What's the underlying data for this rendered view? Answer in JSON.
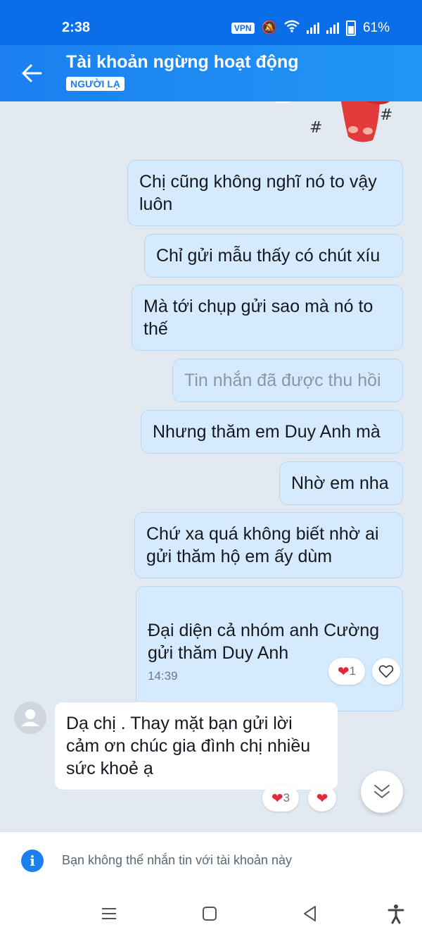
{
  "status": {
    "time": "2:38",
    "vpn": "VPN",
    "battery": "61%"
  },
  "header": {
    "title": "Tài khoản ngừng hoạt động",
    "badge": "NGƯỜI LẠ"
  },
  "messages": [
    {
      "text": "Chị cũng không nghĩ nó to vậy\nluôn"
    },
    {
      "text": "Chỉ gửi mẫu thấy có chút xíu"
    },
    {
      "text": "Mà tới chụp gửi sao mà nó to\nthế"
    },
    {
      "text": "Tin nhắn đã được thu hồi"
    },
    {
      "text": "Nhưng thăm em Duy Anh mà"
    },
    {
      "text": "Nhờ em nha"
    },
    {
      "text": "Chứ xa quá không biết nhờ ai\ngửi thăm hộ em ấy dùm"
    },
    {
      "text": "Đại diện cả nhóm anh Cường\ngửi thăm Duy Anh",
      "time": "14:39"
    },
    {
      "text": "Dạ chị . Thay mặt bạn gửi lời\ncảm ơn chúc gia đình chị nhiều\nsức khoẻ ạ"
    }
  ],
  "reactions": {
    "outgoing_count": "1",
    "incoming_count": "3"
  },
  "footer": {
    "notice": "Bạn không thể nhắn tin với tài khoản này"
  },
  "colors": {
    "header": "#1b7ff0",
    "outgoing_bubble": "#d5ebfd",
    "incoming_bubble": "#ffffff",
    "heart": "#e02b3a"
  }
}
